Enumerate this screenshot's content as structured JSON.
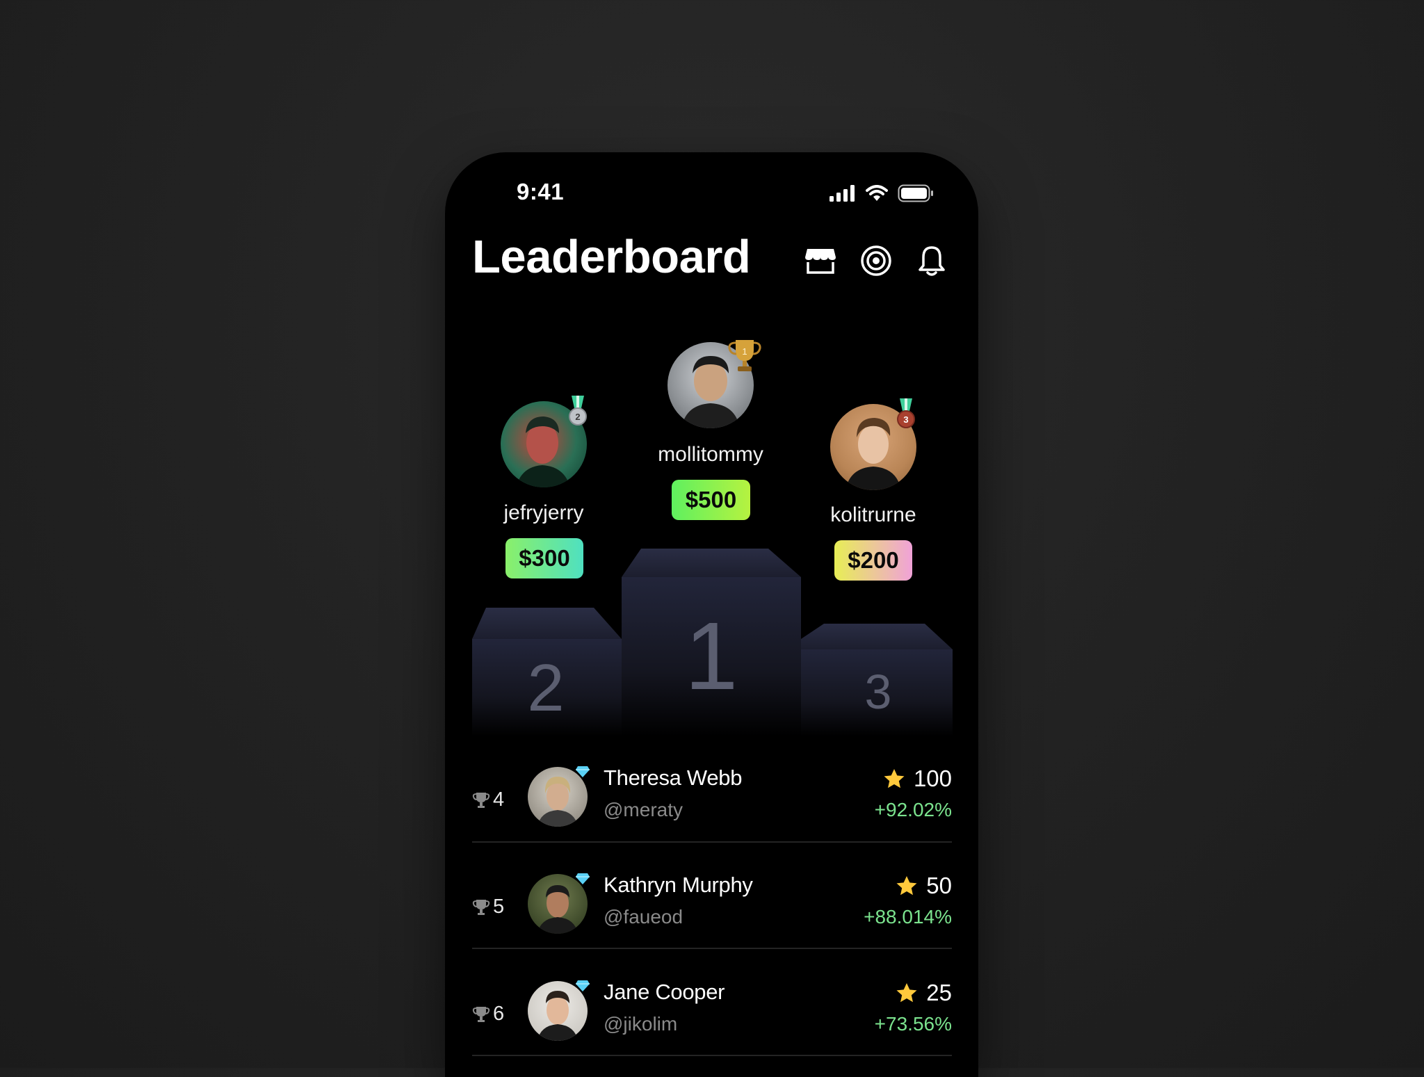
{
  "status_bar": {
    "time": "9:41"
  },
  "header": {
    "title": "Leaderboard",
    "icons": [
      "store-icon",
      "target-icon",
      "bell-icon"
    ]
  },
  "podium": {
    "first": {
      "place": "1",
      "username": "mollitommy",
      "prize": "$500",
      "medal": "trophy-icon",
      "medal_number": "1"
    },
    "second": {
      "place": "2",
      "username": "jefryjerry",
      "prize": "$300",
      "medal": "silver-medal-icon",
      "medal_number": "2"
    },
    "third": {
      "place": "3",
      "username": "kolitrurne",
      "prize": "$200",
      "medal": "bronze-medal-icon",
      "medal_number": "3"
    }
  },
  "list": [
    {
      "rank": "4",
      "name": "Theresa Webb",
      "handle": "@meraty",
      "score": "100",
      "change": "+92.02%"
    },
    {
      "rank": "5",
      "name": "Kathryn Murphy",
      "handle": "@faueod",
      "score": "50",
      "change": "+88.014%"
    },
    {
      "rank": "6",
      "name": "Jane Cooper",
      "handle": "@jikolim",
      "score": "25",
      "change": "+73.56%"
    }
  ],
  "colors": {
    "background": "#232323",
    "phone": "#000000",
    "positive": "#7be38e",
    "prize_first": "#86f34a",
    "prize_second": "#5fe6a8",
    "prize_third": "#f2a3c8",
    "podium": "#1b1d2a"
  }
}
